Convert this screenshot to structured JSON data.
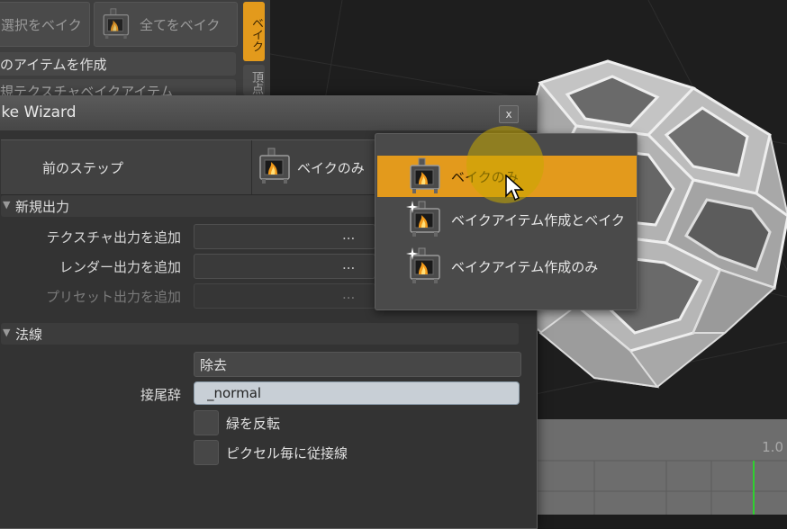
{
  "background_panel": {
    "bake_selected_label": "選択をベイク",
    "bake_all_label": "全てをベイク",
    "create_item_label": "のアイテムを作成",
    "obscured_row_label": "規テクスチャベイクアイテム",
    "tabs": [
      "ベイク",
      "頂点"
    ]
  },
  "dialog": {
    "title": "ake Wizard",
    "close_label": "x",
    "prev_step_label": "前のステップ",
    "bake_mode_value": "ベイクのみ",
    "sections": {
      "new_output": "新規出力",
      "normal": "法線"
    },
    "new_output": {
      "add_texture_label": "テクスチャ出力を追加",
      "add_render_label": "レンダー出力を追加",
      "add_preset_label": "プリセット出力を追加",
      "field_dots": "..."
    },
    "normal": {
      "remove_value": "除去",
      "suffix_label": "接尾辞",
      "suffix_value": "_normal",
      "flip_green_label": "緑を反転",
      "per_pixel_label": "ピクセル毎に従接線"
    }
  },
  "dropdown": {
    "items": [
      {
        "label": "ベイクのみ",
        "selected": true
      },
      {
        "label": "ベイクアイテム作成とベイク",
        "selected": false
      },
      {
        "label": "ベイクアイテム作成のみ",
        "selected": false
      }
    ]
  },
  "viewport": {
    "timeline_label": "1.0"
  },
  "colors": {
    "accent": "#e39a1c",
    "dialog_bg": "#333333",
    "viewport_bg": "#1e1e1e"
  }
}
